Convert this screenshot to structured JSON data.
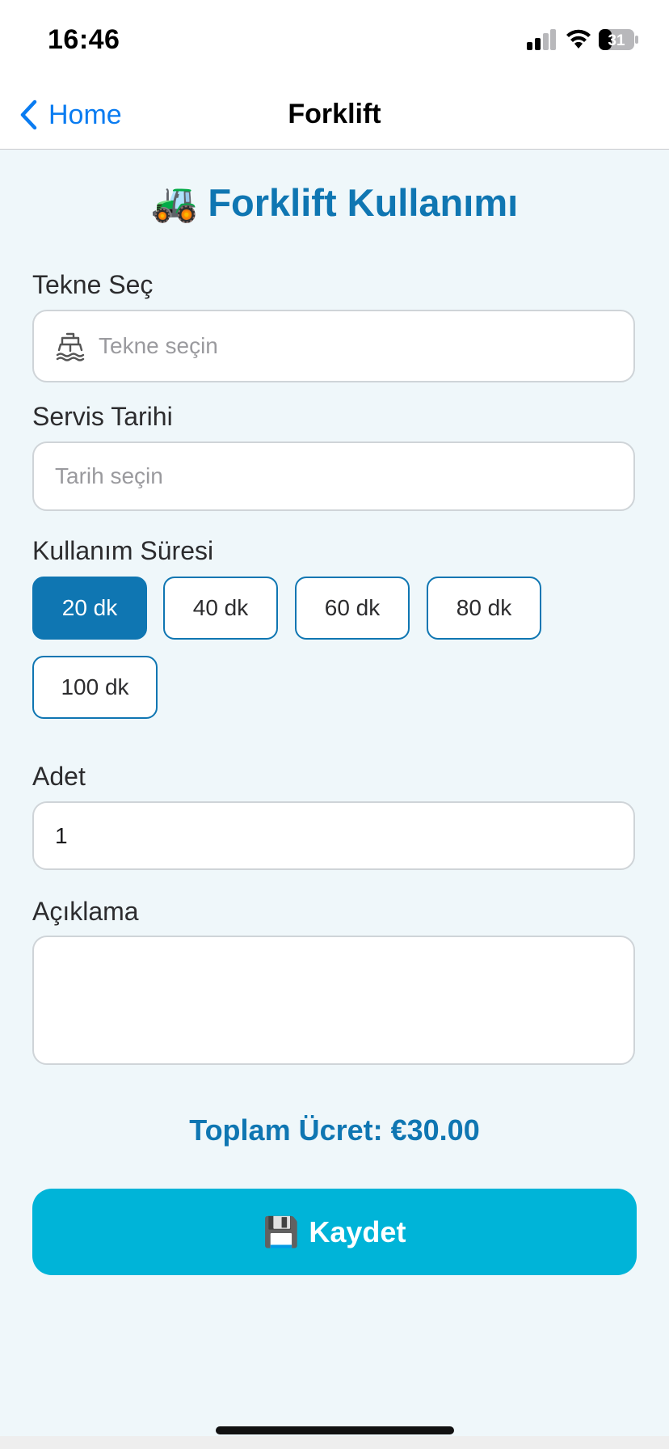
{
  "status_bar": {
    "time": "16:46",
    "battery_level": "31",
    "icons": [
      "signal-icon",
      "wifi-icon",
      "battery-icon"
    ]
  },
  "nav": {
    "back_label": "Home",
    "title": "Forklift",
    "accent_color": "#0a7cf1"
  },
  "page": {
    "heading_emoji": "🚜",
    "heading": "Forklift Kullanımı",
    "primary_color": "#0f76b2"
  },
  "form": {
    "boat": {
      "label": "Tekne Seç",
      "placeholder": "Tekne seçin",
      "icon": "boat-icon"
    },
    "date": {
      "label": "Servis Tarihi",
      "placeholder": "Tarih seçin"
    },
    "duration": {
      "label": "Kullanım Süresi",
      "options": [
        "20 dk",
        "40 dk",
        "60 dk",
        "80 dk",
        "100 dk"
      ],
      "selected": "20 dk"
    },
    "quantity": {
      "label": "Adet",
      "value": "1"
    },
    "description": {
      "label": "Açıklama",
      "value": ""
    }
  },
  "total": {
    "text": "Toplam Ücret: €30.00"
  },
  "save": {
    "icon_emoji": "💾",
    "label": "Kaydet",
    "color": "#00b4d8"
  }
}
